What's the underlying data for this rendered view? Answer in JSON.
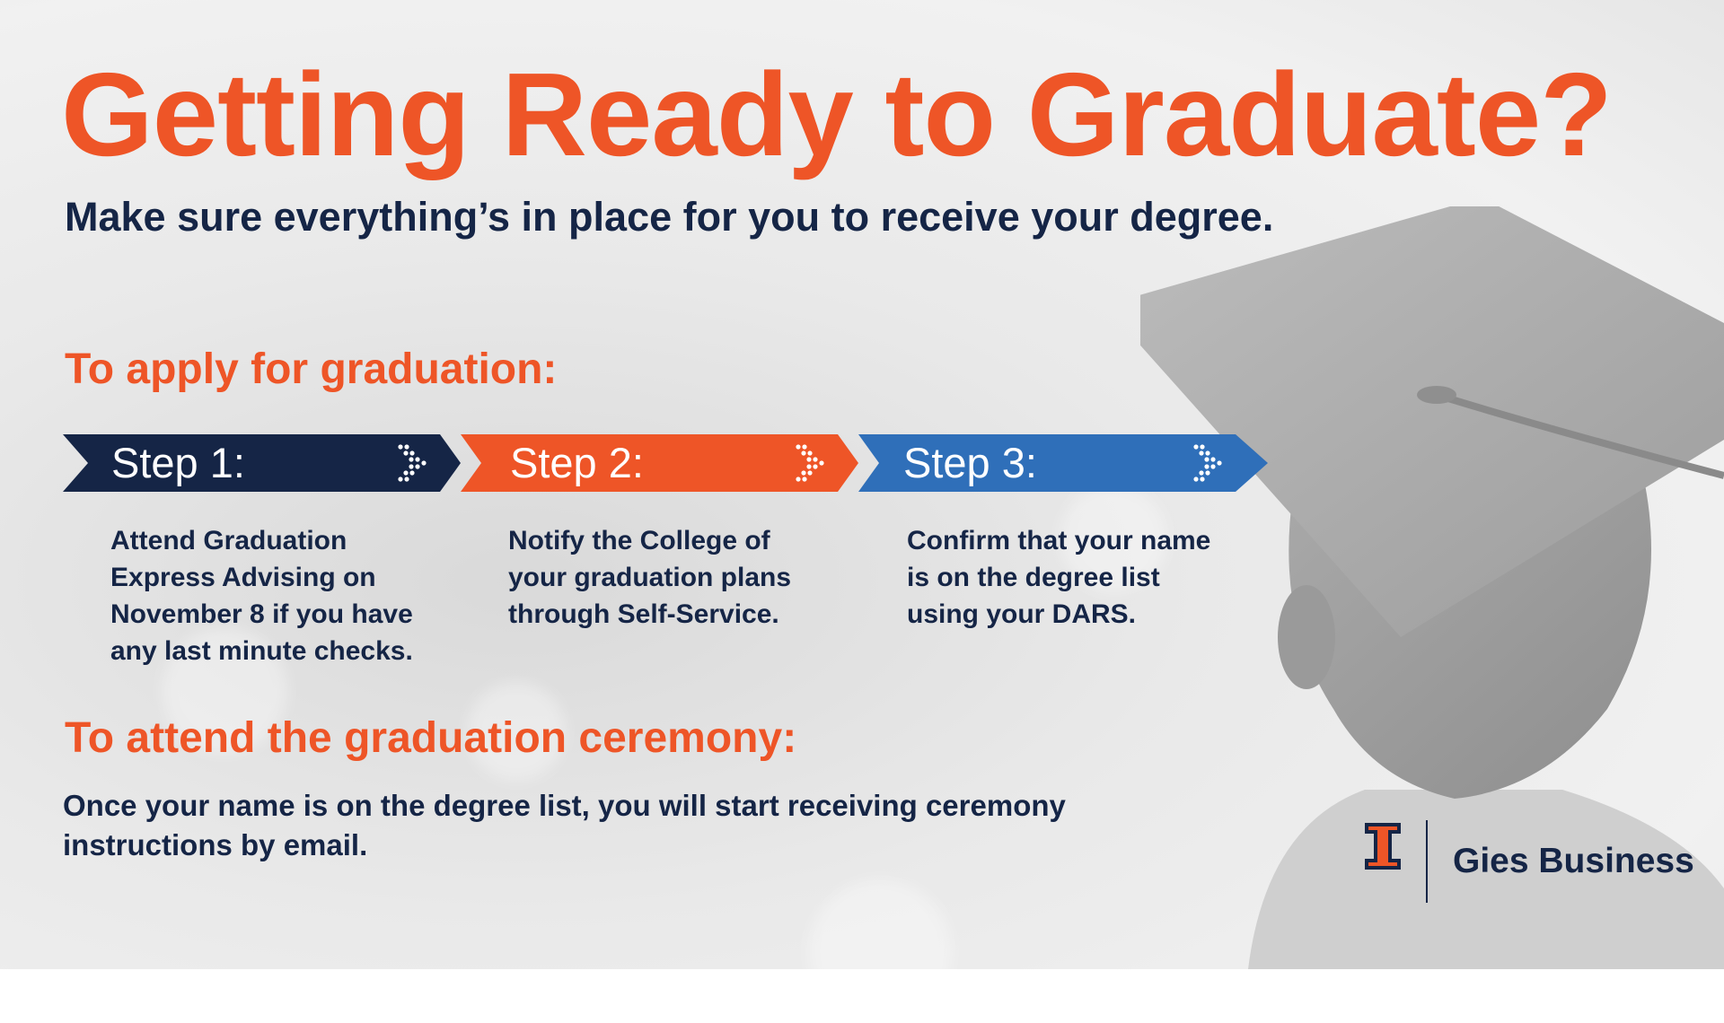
{
  "title": "Getting Ready to Graduate?",
  "subtitle": "Make sure everything’s in place for you to receive your degree.",
  "apply_heading": "To apply for graduation:",
  "steps": [
    {
      "label": "Step 1:",
      "color": "#152546",
      "lines": [
        "Attend Graduation",
        "Express Advising on",
        "November 8 if you have",
        "any last minute checks."
      ]
    },
    {
      "label": "Step 2:",
      "color": "#ee5527",
      "lines": [
        "Notify the College of",
        "your graduation plans",
        "through Self-Service."
      ]
    },
    {
      "label": "Step 3:",
      "color": "#2f6fb9",
      "lines": [
        "Confirm that your name",
        "is on the degree list",
        "using your DARS."
      ]
    }
  ],
  "ceremony_heading": "To attend the graduation ceremony:",
  "ceremony_text": "Once your name is on the degree list, you will start receiving ceremony instructions by email.",
  "brand": {
    "name": "Gies Business",
    "mark_color": "#ee5527"
  },
  "colors": {
    "orange": "#ee5527",
    "navy": "#152546",
    "blue": "#2f6fb9"
  },
  "icons": [
    "graduate-figure-image",
    "dotted-chevron-icon",
    "block-i-logo"
  ]
}
